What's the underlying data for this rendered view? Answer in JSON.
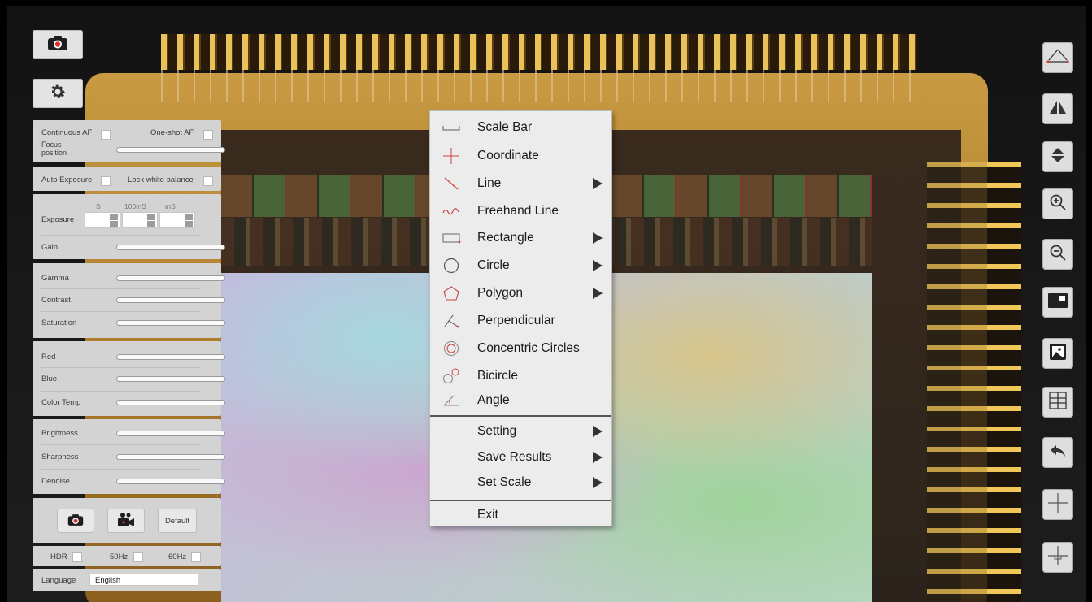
{
  "top_buttons": {
    "camera_icon": "camera-icon",
    "settings_icon": "gear-icon"
  },
  "focus_panel": {
    "continuous_af_label": "Continuous AF",
    "one_shot_af_label": "One-shot AF",
    "focus_position_label_line1": "Focus",
    "focus_position_label_line2": "position"
  },
  "exposure_lock_panel": {
    "auto_exposure_label": "Auto Exposure",
    "lock_white_balance_label": "Lock white balance"
  },
  "exposure_panel": {
    "unit_s": "S",
    "unit_100ms": "100mS",
    "unit_ms": "mS",
    "exposure_label": "Exposure",
    "gain_label": "Gain"
  },
  "tone_panel": {
    "gamma_label": "Gamma",
    "contrast_label": "Contrast",
    "saturation_label": "Saturation"
  },
  "color_panel": {
    "red_label": "Red",
    "blue_label": "Blue",
    "color_temp_label": "Color Temp"
  },
  "image_panel": {
    "brightness_label": "Brightness",
    "sharpness_label": "Sharpness",
    "denoise_label": "Denoise"
  },
  "capture_panel": {
    "snapshot_icon": "camera-icon",
    "record_icon": "video-camera-icon",
    "default_label": "Default"
  },
  "mode_panel": {
    "hdr_label": "HDR",
    "hz50_label": "50Hz",
    "hz60_label": "60Hz"
  },
  "language_panel": {
    "label": "Language",
    "value": "English"
  },
  "context_menu": {
    "items": [
      {
        "label": "Scale Bar",
        "icon": "scale-bar-icon"
      },
      {
        "label": "Coordinate",
        "icon": "coordinate-icon"
      },
      {
        "label": "Line",
        "icon": "line-icon"
      },
      {
        "label": "Freehand Line",
        "icon": "freehand-line-icon"
      },
      {
        "label": "Rectangle",
        "icon": "rectangle-icon"
      },
      {
        "label": "Circle",
        "icon": "circle-icon"
      },
      {
        "label": "Polygon",
        "icon": "polygon-icon"
      },
      {
        "label": "Perpendicular",
        "icon": "perpendicular-icon"
      },
      {
        "label": "Concentric Circles",
        "icon": "concentric-circles-icon"
      },
      {
        "label": "Bicircle",
        "icon": "bicircle-icon"
      },
      {
        "label": "Angle",
        "icon": "angle-icon"
      }
    ],
    "setting_label": "Setting",
    "save_results_label": "Save Results",
    "set_scale_label": "Set Scale",
    "exit_label": "Exit"
  },
  "right_toolbar": {
    "icons": [
      "measurement-ruler-icon",
      "flip-horizontal-icon",
      "flip-vertical-icon",
      "zoom-in-icon",
      "zoom-out-icon",
      "picture-in-picture-icon",
      "image-gallery-icon",
      "grid-layout-icon",
      "undo-icon",
      "crosshair-icon",
      "crosshair-box-icon"
    ]
  },
  "colors": {
    "panel_bg": "#d3d3d3",
    "menu_bg": "#ececec",
    "accent_red": "#d03030"
  }
}
